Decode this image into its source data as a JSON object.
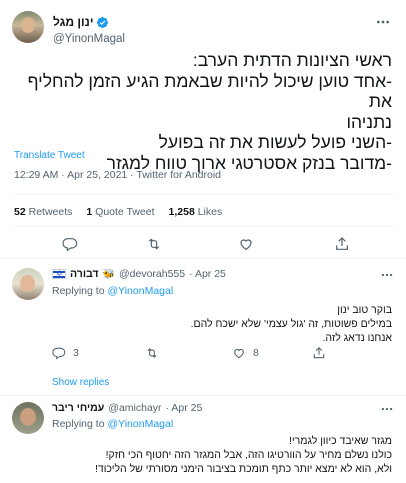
{
  "tweet": {
    "display_name": "ינון מגל",
    "handle": "@YinonMagal",
    "lines": [
      "ראשי הציונות הדתית הערב:",
      "-אחד טוען שיכול להיות שבאמת הגיע הזמן להחליף את",
      "נתניהו",
      "-השני פועל לעשות את זה בפועל",
      "-מדובר בנזק אסטרטגי ארוך טווח למגזר"
    ],
    "translate_label": "Translate Tweet",
    "meta": "12:29 AM · Apr 25, 2021 · Twitter for Android",
    "stats": {
      "retweets_count": "52",
      "retweets_label": "Retweets",
      "quotes_count": "1",
      "quotes_label": "Quote Tweet",
      "likes_count": "1,258",
      "likes_label": "Likes"
    }
  },
  "replies": [
    {
      "display_name": "דבורה",
      "handle": "@devorah555",
      "date": "· Apr 25",
      "replying_prefix": "Replying to",
      "replying_handle": "@YinonMagal",
      "lines": [
        "בוקר טוב ינון",
        "במילים פשוטות, זה 'גול עצמי' שלא ישכח להם.",
        "אנחנו נדאג לזה."
      ],
      "reply_count": "3",
      "like_count": "8",
      "show_replies": "Show replies"
    },
    {
      "display_name": "עמיחי ריבר",
      "handle": "@amichayr",
      "date": "· Apr 25",
      "replying_prefix": "Replying to",
      "replying_handle": "@YinonMagal",
      "lines": [
        "מגזר שאיבד כיוון לגמרי!",
        "כולנו נשלם מחיר על הוורטיגו הזה, אבל המגזר הזה יחטוף הכי חזק!",
        "ולא, הוא לא ימצא יותר כתף תומכת בציבור הימני מסורתי של הליכוד!"
      ]
    }
  ],
  "icons": {
    "verified": "verified-badge-icon",
    "more": "more-horizontal-icon",
    "reply": "reply-icon",
    "retweet": "retweet-icon",
    "like": "heart-icon",
    "share": "share-icon"
  },
  "colors": {
    "accent": "#1d9bf0",
    "text": "#0f1419",
    "muted": "#536471",
    "border": "#eff3f4"
  }
}
